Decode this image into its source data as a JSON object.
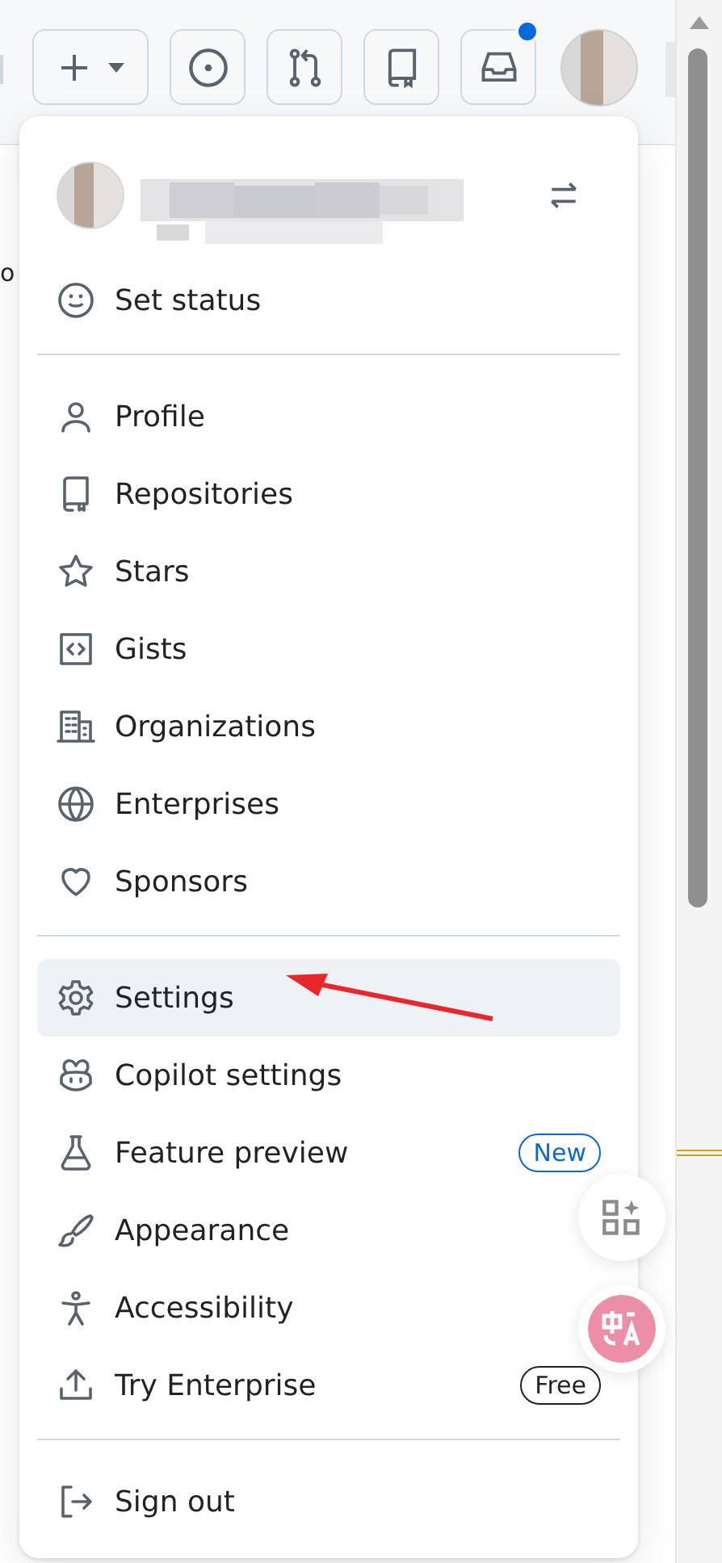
{
  "toolbar": {
    "unread_notifications": true
  },
  "page_edge_text": "o",
  "menu": {
    "status_item": {
      "label": "Set status"
    },
    "groups": [
      [
        {
          "label": "Profile",
          "selected": false
        },
        {
          "label": "Repositories",
          "selected": false
        },
        {
          "label": "Stars",
          "selected": false
        },
        {
          "label": "Gists",
          "selected": false
        },
        {
          "label": "Organizations",
          "selected": false
        },
        {
          "label": "Enterprises",
          "selected": false
        },
        {
          "label": "Sponsors",
          "selected": false
        }
      ],
      [
        {
          "label": "Settings",
          "selected": true
        },
        {
          "label": "Copilot settings",
          "selected": false
        },
        {
          "label": "Feature preview",
          "selected": false,
          "badge": {
            "text": "New",
            "kind": "accent"
          }
        },
        {
          "label": "Appearance",
          "selected": false
        },
        {
          "label": "Accessibility",
          "selected": false
        },
        {
          "label": "Try Enterprise",
          "selected": false,
          "badge": {
            "text": "Free",
            "kind": "plain"
          }
        }
      ],
      [
        {
          "label": "Sign out",
          "selected": false
        }
      ]
    ]
  }
}
